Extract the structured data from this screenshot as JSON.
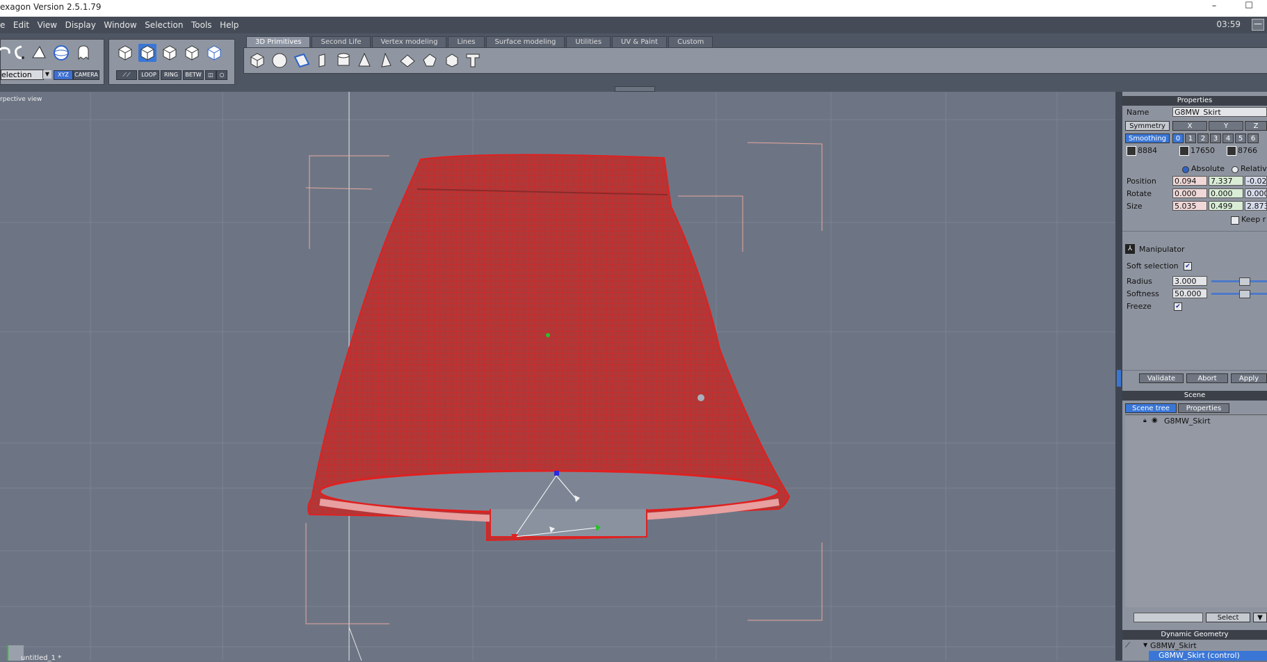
{
  "window": {
    "title": "exagon Version 2.5.1.79",
    "minimize": "–",
    "maximize": "☐"
  },
  "menu": {
    "items": [
      "e",
      "Edit",
      "View",
      "Display",
      "Window",
      "Selection",
      "Tools",
      "Help"
    ],
    "clock": "03:59",
    "collapse": "—"
  },
  "toolbar": {
    "tabs": [
      "3D Primitives",
      "Second Life",
      "Vertex modeling",
      "Lines",
      "Surface modeling",
      "Utilities",
      "UV & Paint",
      "Custom"
    ],
    "active_tab": "3D Primitives",
    "selection_value": "election",
    "xyz_label": "XYZ",
    "camera_label": "CAMERA",
    "loop_label": "LOOP",
    "ring_label": "RING",
    "betw_label": "BETW"
  },
  "viewport": {
    "label": "rpective view",
    "document": "untitled_1 *"
  },
  "properties": {
    "header": "Properties",
    "name_label": "Name",
    "name_value": "G8MW_Skirt",
    "symmetry_label": "Symmetry",
    "axis_x": "X",
    "axis_y": "Y",
    "axis_z": "Z",
    "smoothing_label": "Smoothing",
    "smoothing_levels": [
      "0",
      "1",
      "2",
      "3",
      "4",
      "5",
      "6"
    ],
    "count_vertices": "8884",
    "count_edges": "17650",
    "count_faces": "8766",
    "absolute_label": "Absolute",
    "relative_label": "Relativ",
    "position_label": "Position",
    "position": [
      "0.094",
      "7.337",
      "-0.02"
    ],
    "rotate_label": "Rotate",
    "rotate": [
      "0.000",
      "0.000",
      "0.000"
    ],
    "size_label": "Size",
    "size": [
      "5.035",
      "0.499",
      "2.873"
    ],
    "keep_label": "Keep r",
    "manipulator_label": "Manipulator",
    "soft_selection_label": "Soft selection",
    "radius_label": "Radius",
    "radius_value": "3.000",
    "softness_label": "Softness",
    "softness_value": "50.000",
    "freeze_label": "Freeze",
    "validate": "Validate",
    "abort": "Abort",
    "apply": "Apply"
  },
  "scene": {
    "header": "Scene",
    "tab_tree": "Scene tree",
    "tab_props": "Properties",
    "item": "G8MW_Skirt",
    "select_label": "Select"
  },
  "dynamic": {
    "header": "Dynamic Geometry",
    "item": "G8MW_Skirt",
    "child": "G8MW_Skirt (control)"
  },
  "colors": {
    "mesh_wire": "#e02020",
    "mesh_fill": "#b03838",
    "accent_blue": "#3a76d6",
    "viewport_bg": "#6d7584"
  }
}
